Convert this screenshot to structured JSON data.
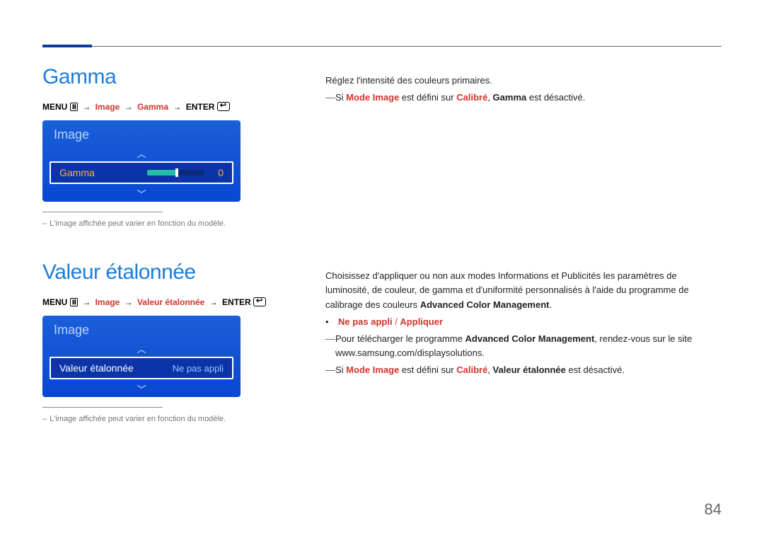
{
  "page_number": "84",
  "gamma": {
    "heading": "Gamma",
    "menu_prefix": "MENU",
    "menu_item1": "Image",
    "menu_item2": "Gamma",
    "menu_enter": "ENTER",
    "ui_title": "Image",
    "ui_label": "Gamma",
    "ui_value": "0",
    "footnote": "L'image affichée peut varier en fonction du modèle.",
    "desc": "Réglez l'intensité des couleurs primaires.",
    "note_prefix": "Si ",
    "note_mi": "Mode Image",
    "note_mid": " est défini sur ",
    "note_cal": "Calibré",
    "note_comma": ", ",
    "note_gamma": "Gamma",
    "note_end": " est désactivé."
  },
  "valeur": {
    "heading": "Valeur étalonnée",
    "menu_prefix": "MENU",
    "menu_item1": "Image",
    "menu_item2": "Valeur étalonnée",
    "menu_enter": "ENTER",
    "ui_title": "Image",
    "ui_label": "Valeur étalonnée",
    "ui_value": "Ne pas appli",
    "footnote": "L'image affichée peut varier en fonction du modèle.",
    "para_a": "Choisissez d'appliquer ou non aux modes Informations et Publicités les paramètres de luminosité, de couleur, de gamma et d'uniformité personnalisés à l'aide du programme de calibrage des couleurs ",
    "para_b_bold": "Advanced Color Management",
    "para_c": ".",
    "bullet_a": "Ne pas appli",
    "bullet_sep": " / ",
    "bullet_b": "Appliquer",
    "note1_a": "Pour télécharger le programme ",
    "note1_b_bold": "Advanced Color Management",
    "note1_c": ", rendez-vous sur le site www.samsung.com/displaysolutions.",
    "note2_prefix": "Si ",
    "note2_mi": "Mode Image",
    "note2_mid": " est défini sur ",
    "note2_cal": "Calibré",
    "note2_comma": ", ",
    "note2_ve": "Valeur étalonnée",
    "note2_end": " est désactivé."
  }
}
